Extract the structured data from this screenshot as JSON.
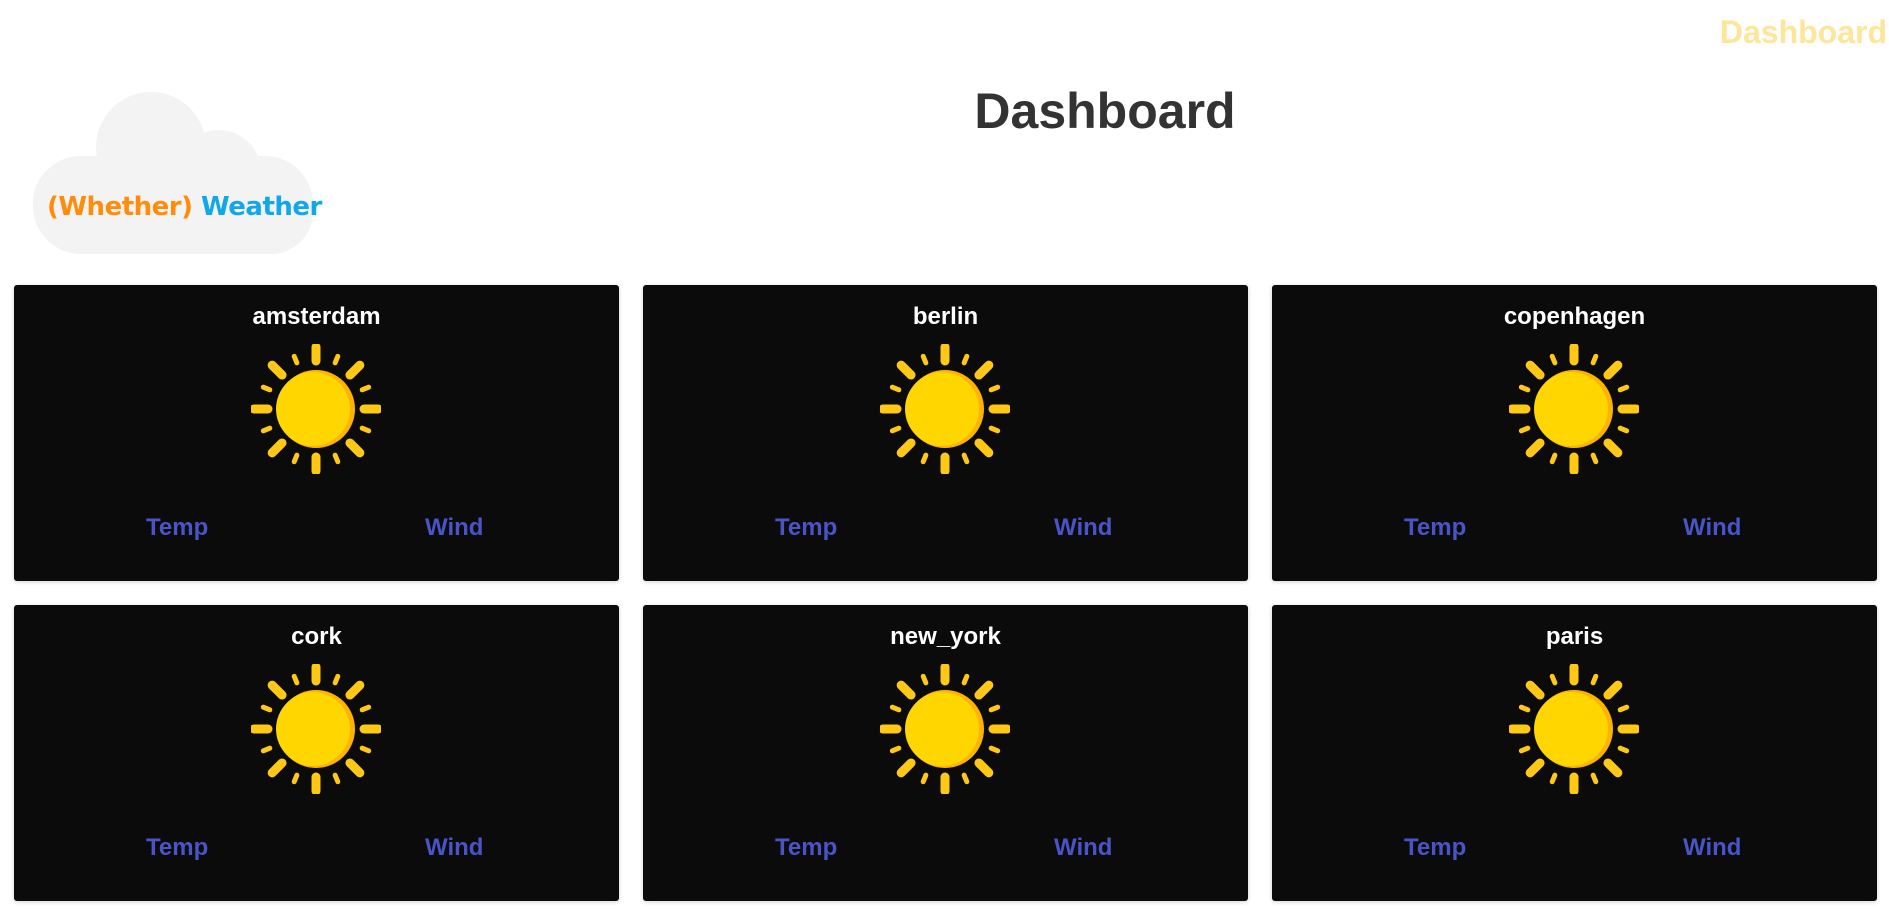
{
  "nav": {
    "dashboard_link": "Dashboard"
  },
  "logo": {
    "part1": "(Whether)",
    "part2": "Weather"
  },
  "page": {
    "title": "Dashboard"
  },
  "colors": {
    "nav_link": "#fde69a",
    "logo_part1": "#ff8c0a",
    "logo_part2": "#12a8e8",
    "card_bg": "#0b0b0b",
    "metric_link": "#4a54c9",
    "sun": "#ffd400"
  },
  "cards": [
    {
      "city": "amsterdam",
      "icon": "sun-icon",
      "temp_label": "Temp",
      "wind_label": "Wind"
    },
    {
      "city": "berlin",
      "icon": "sun-icon",
      "temp_label": "Temp",
      "wind_label": "Wind"
    },
    {
      "city": "copenhagen",
      "icon": "sun-icon",
      "temp_label": "Temp",
      "wind_label": "Wind"
    },
    {
      "city": "cork",
      "icon": "sun-icon",
      "temp_label": "Temp",
      "wind_label": "Wind"
    },
    {
      "city": "new_york",
      "icon": "sun-icon",
      "temp_label": "Temp",
      "wind_label": "Wind"
    },
    {
      "city": "paris",
      "icon": "sun-icon",
      "temp_label": "Temp",
      "wind_label": "Wind"
    }
  ]
}
